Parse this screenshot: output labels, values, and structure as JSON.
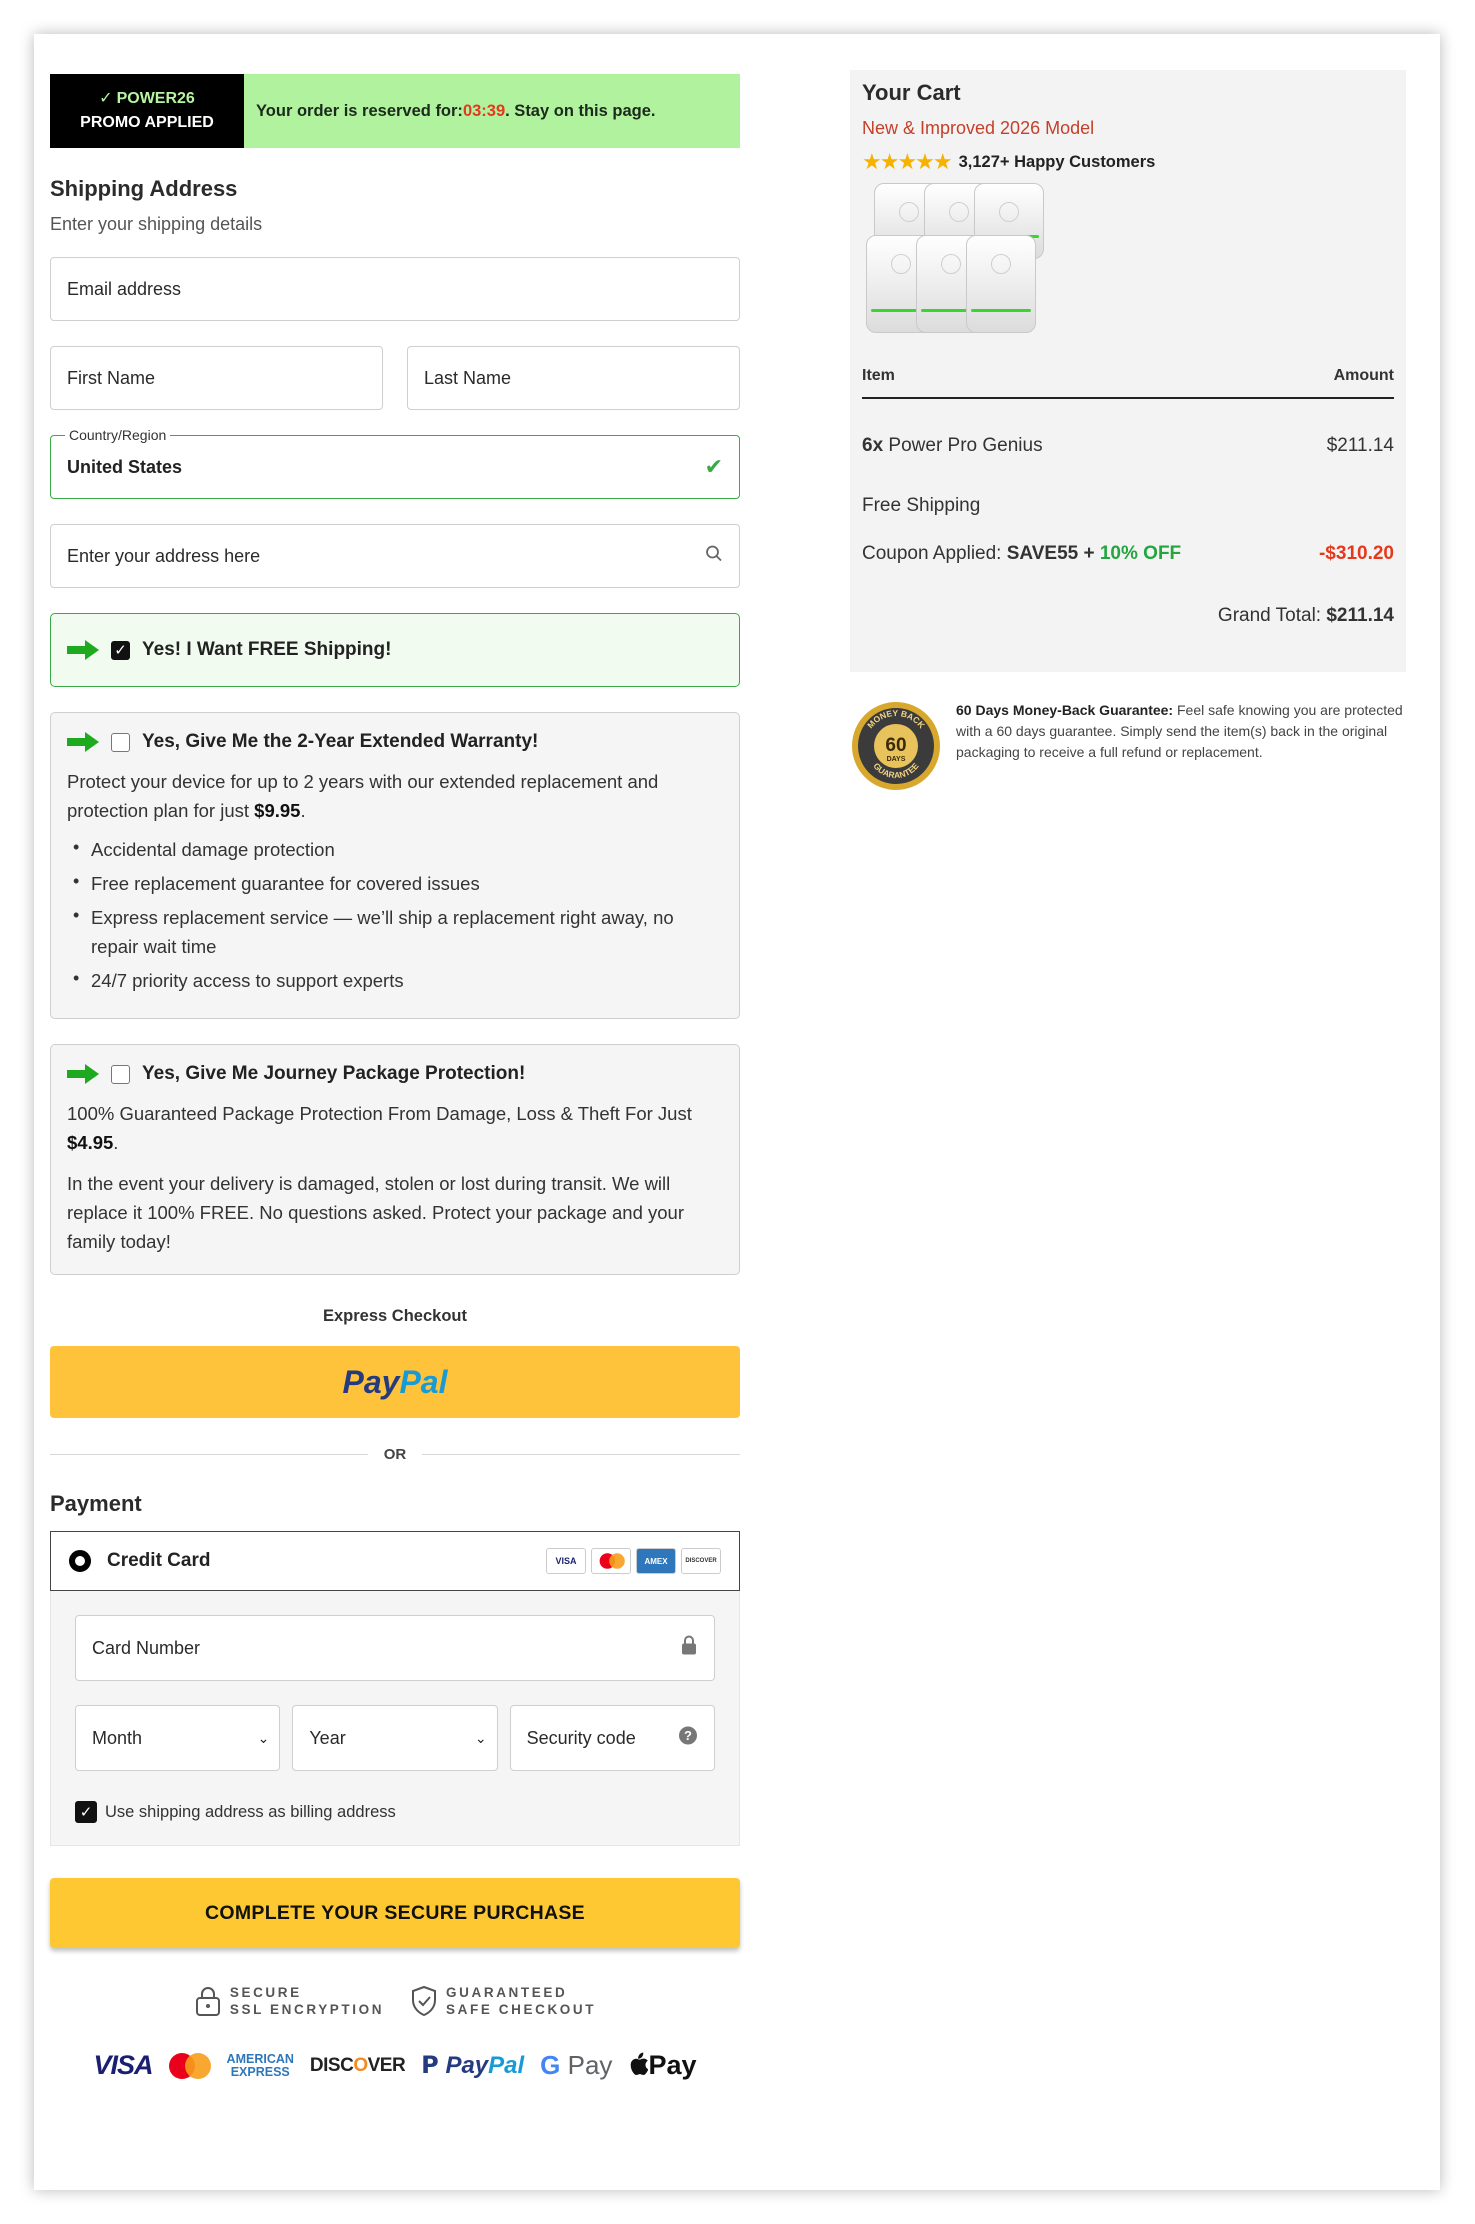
{
  "banner": {
    "promo_code": "POWER26",
    "promo_status": "PROMO APPLIED",
    "reserve_text": "Your order is reserved for: ",
    "timer": "03:39",
    "reserve_suffix": ". Stay on this page."
  },
  "shipping": {
    "title": "Shipping Address",
    "subtitle": "Enter your shipping details",
    "email_placeholder": "Email address",
    "first_name_placeholder": "First Name",
    "last_name_placeholder": "Last Name",
    "country_label": "Country/Region",
    "country_value": "United States",
    "address_placeholder": "Enter your address here"
  },
  "offers": {
    "free_shipping_label": "Yes! I Want FREE Shipping!",
    "free_shipping_checked": true,
    "warranty": {
      "label": "Yes, Give Me the 2-Year Extended Warranty!",
      "checked": false,
      "desc": "Protect your device for up to 2 years with our extended replacement and protection plan for just ",
      "price": "$9.95",
      "desc_end": ".",
      "bullets": [
        "Accidental damage protection",
        "Free replacement guarantee for covered issues",
        "Express replacement service — we’ll ship a replacement right away, no repair wait time",
        "24/7 priority access to support experts"
      ]
    },
    "protection": {
      "label": "Yes, Give Me Journey Package Protection!",
      "checked": false,
      "desc1": "100% Guaranteed Package Protection From Damage, Loss & Theft For Just ",
      "price": "$4.95",
      "desc1_end": ".",
      "desc2": "In the event your delivery is damaged, stolen or lost during transit. We will replace it 100% FREE. No questions asked. Protect your package and your family today!"
    }
  },
  "express": {
    "label": "Express Checkout",
    "paypal_pay": "Pay",
    "paypal_pal": "Pal",
    "or": "OR"
  },
  "payment": {
    "title": "Payment",
    "method": "Credit Card",
    "card_icons": [
      "VISA",
      "MC",
      "AMEX",
      "DISCOVER"
    ],
    "card_number_placeholder": "Card Number",
    "month_placeholder": "Month",
    "year_placeholder": "Year",
    "security_placeholder": "Security code",
    "billing_label": "Use shipping address as billing address",
    "billing_checked": true,
    "submit_label": "COMPLETE YOUR SECURE PURCHASE"
  },
  "trust": {
    "ssl_line1": "SECURE",
    "ssl_line2": "SSL ENCRYPTION",
    "safe_line1": "GUARANTEED",
    "safe_line2": "SAFE CHECKOUT"
  },
  "logos": {
    "visa": "VISA",
    "amex_line1": "AMERICAN",
    "amex_line2": "EXPRESS",
    "discover_a": "DISC",
    "discover_o": "O",
    "discover_b": "VER",
    "paypal_pay": "Pay",
    "paypal_pal": "Pal",
    "gpay_g": "G",
    "gpay_text": " Pay",
    "apay": "Pay"
  },
  "cart": {
    "title": "Your Cart",
    "subtitle": "New & Improved 2026 Model",
    "stars": "★★★★★",
    "rating_text": "3,127+ Happy Customers",
    "col_item": "Item",
    "col_amount": "Amount",
    "item_qty": "6x",
    "item_name": " Power Pro Genius",
    "item_price": "$211.14",
    "shipping_text": "Free Shipping",
    "coupon_label": "Coupon Applied: ",
    "coupon_code": "SAVE55",
    "coupon_plus": " + ",
    "coupon_extra": "10% OFF",
    "coupon_amount": "-$310.20",
    "grand_label": "Grand Total: ",
    "grand_value": "$211.14"
  },
  "guarantee": {
    "seal_top": "MONEY BACK",
    "seal_num": "60",
    "seal_days": "DAYS",
    "seal_bottom": "GUARANTEE",
    "title": "60 Days Money-Back Guarantee:",
    "text": " Feel safe knowing you are protected with a 60 days guarantee. Simply send the item(s) back in the original packaging to receive a full refund or replacement."
  },
  "colors": {
    "promo_green": "#b0f29e",
    "timer_red": "#e5391d",
    "accent_green": "#3aaa47",
    "paypal_yellow": "#fec33a",
    "purchase_yellow": "#fdc832"
  }
}
